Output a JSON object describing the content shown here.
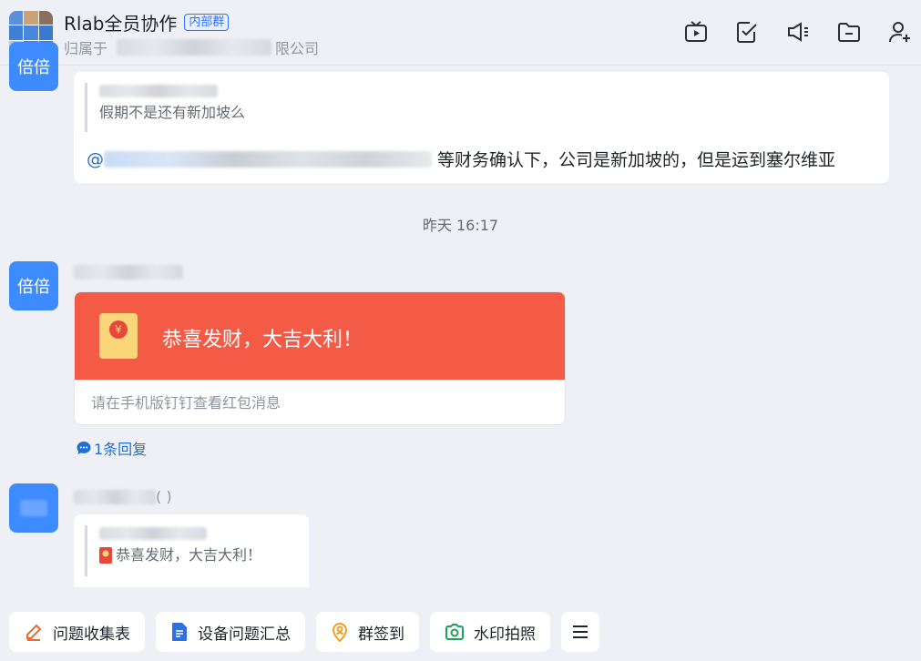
{
  "header": {
    "title": "Rlab全员协作",
    "badge": "内部群",
    "subtitle_prefix": "归属于",
    "subtitle_suffix": "限公司"
  },
  "messages": {
    "top_avatar_label": "倍倍",
    "first": {
      "quote_text": "假期不是还有新加坡么",
      "mention_symbol": "@",
      "body_text": "等财务确认下，公司是新加坡的，但是运到塞尔维亚"
    },
    "time_divider": "昨天 16:17",
    "second": {
      "avatar_label": "倍倍",
      "red_packet_title": "恭喜发财，大吉大利！",
      "red_packet_note": "请在手机版钉钉查看红包消息",
      "reply_count": "1条回复"
    },
    "third": {
      "name_suffix": "( )",
      "quote_text": "恭喜发财，大吉大利！"
    }
  },
  "shortcuts": [
    {
      "label": "问题收集表",
      "icon": "pencil-icon"
    },
    {
      "label": "设备问题汇总",
      "icon": "document-icon"
    },
    {
      "label": "群签到",
      "icon": "location-pin-icon"
    },
    {
      "label": "水印拍照",
      "icon": "camera-icon"
    }
  ],
  "colors": {
    "accent": "#3370ff",
    "avatar_blue": "#3d8bff",
    "red_packet": "#f35b47",
    "background": "#eef0f6"
  }
}
